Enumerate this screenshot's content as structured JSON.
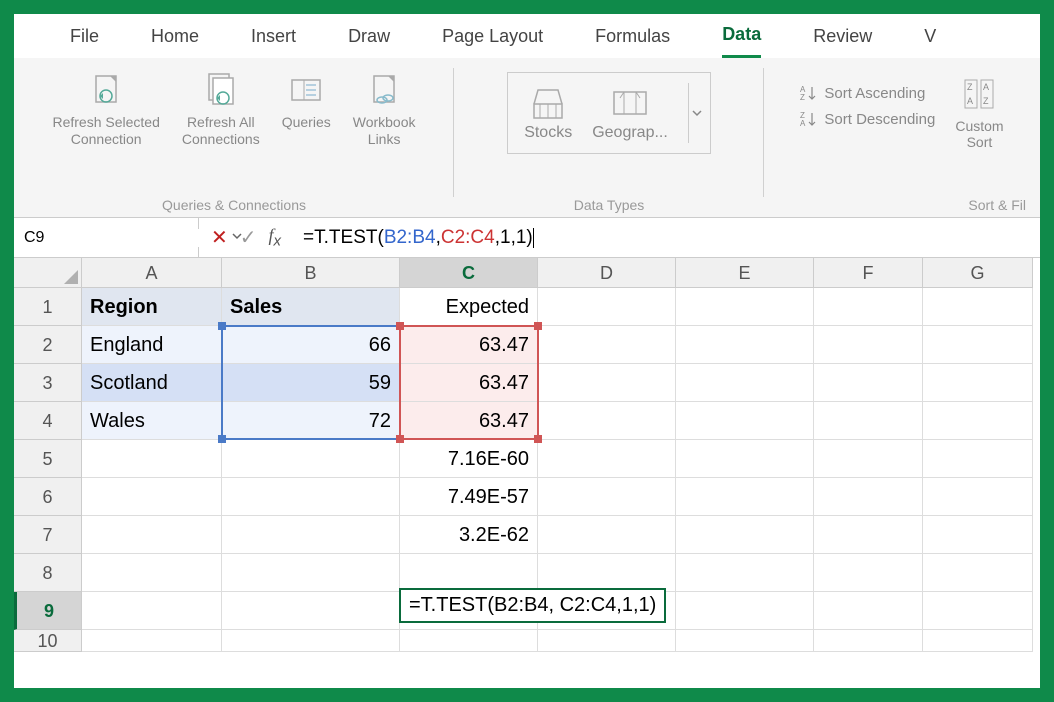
{
  "tabs": [
    "File",
    "Home",
    "Insert",
    "Draw",
    "Page Layout",
    "Formulas",
    "Data",
    "Review",
    "V"
  ],
  "active_tab": "Data",
  "ribbon": {
    "queries": {
      "refresh_selected": "Refresh Selected\nConnection",
      "refresh_all": "Refresh All\nConnections",
      "queries": "Queries",
      "workbook_links": "Workbook\nLinks",
      "group_label": "Queries & Connections"
    },
    "data_types": {
      "stocks": "Stocks",
      "geography": "Geograp...",
      "group_label": "Data Types"
    },
    "sort": {
      "asc": "Sort Ascending",
      "desc": "Sort Descending",
      "custom": "Custom\nSort",
      "group_label": "Sort & Fil"
    }
  },
  "name_box": "C9",
  "formula": {
    "prefix": "=T.TEST(",
    "arg1": "B2:B4",
    "sep1": ", ",
    "arg2": "C2:C4",
    "suffix": ",1,1)"
  },
  "columns": [
    "A",
    "B",
    "C",
    "D",
    "E",
    "F",
    "G"
  ],
  "rows": [
    "1",
    "2",
    "3",
    "4",
    "5",
    "6",
    "7",
    "8",
    "9",
    "10"
  ],
  "data": {
    "A1": "Region",
    "B1": "Sales",
    "C1": "Expected",
    "A2": "England",
    "B2": "66",
    "C2": "63.47",
    "A3": "Scotland",
    "B3": "59",
    "C3": "63.47",
    "A4": "Wales",
    "B4": "72",
    "C4": "63.47",
    "C5": "7.16E-60",
    "C6": "7.49E-57",
    "C7": "3.2E-62"
  },
  "editing_formula": "=T.TEST(B2:B4, C2:C4,1,1)"
}
